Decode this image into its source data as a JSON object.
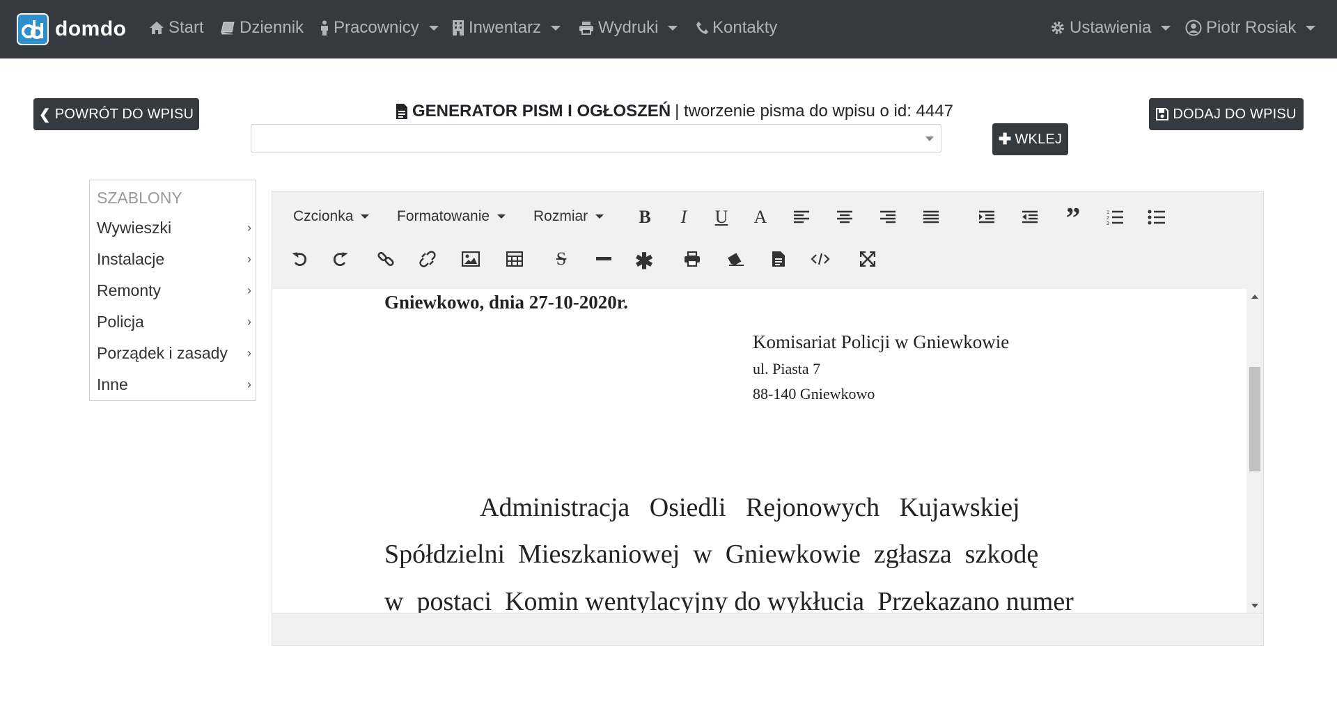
{
  "navbar": {
    "brand": "domdo",
    "items": [
      {
        "label": "Start",
        "icon": "home-icon"
      },
      {
        "label": "Dziennik",
        "icon": "book-icon"
      },
      {
        "label": "Pracownicy",
        "icon": "person-icon",
        "dropdown": true
      },
      {
        "label": "Inwentarz",
        "icon": "building-icon",
        "dropdown": true
      },
      {
        "label": "Wydruki",
        "icon": "printer-icon",
        "dropdown": true
      },
      {
        "label": "Kontakty",
        "icon": "phone-icon"
      }
    ],
    "settings": "Ustawienia",
    "user": "Piotr Rosiak"
  },
  "actions": {
    "back": "POWRÓT DO WPISU",
    "add": "DODAJ DO WPISU",
    "paste": "WKLEJ"
  },
  "header": {
    "title": "GENERATOR PISM I OGŁOSZEŃ",
    "subtitle": "| tworzenie pisma do wpisu o id: 4447"
  },
  "template_select": {
    "value": ""
  },
  "sidebar": {
    "title": "SZABLONY",
    "items": [
      {
        "label": "Wywieszki"
      },
      {
        "label": "Instalacje"
      },
      {
        "label": "Remonty"
      },
      {
        "label": "Policja"
      },
      {
        "label": "Porządek i zasady"
      },
      {
        "label": "Inne"
      }
    ]
  },
  "toolbar": {
    "font": "Czcionka",
    "format": "Formatowanie",
    "size": "Rozmiar"
  },
  "document": {
    "date_line": "Gniewkowo, dnia 27-10-2020r.",
    "recipient": "Komisariat Policji w Gniewkowie",
    "street": "ul. Piasta 7",
    "city": "88-140 Gniewkowo",
    "body_line1": "Administracja   Osiedli   Rejonowych   Kujawskiej",
    "body_line2": "Spółdzielni  Mieszkaniowej  w  Gniewkowie  zgłasza  szkodę",
    "body_line3": "w  postaci  Komin wentylacyjny do wykłucia  Przekazano numer"
  },
  "colors": {
    "navbar": "#343a40",
    "button": "#343a40",
    "logo": "#2f8fcc"
  }
}
